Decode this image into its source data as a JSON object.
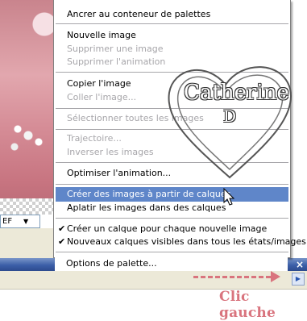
{
  "menu": {
    "items": [
      {
        "label": "Ancrer au conteneur de palettes",
        "enabled": true
      },
      {
        "label": "Nouvelle image",
        "enabled": true
      },
      {
        "label": "Supprimer une image",
        "enabled": false
      },
      {
        "label": "Supprimer l'animation",
        "enabled": false
      },
      {
        "label": "Copier l'image",
        "enabled": true
      },
      {
        "label": "Coller l'image...",
        "enabled": false
      },
      {
        "label": "Sélectionner toutes les images",
        "enabled": false
      },
      {
        "label": "Trajectoire...",
        "enabled": false
      },
      {
        "label": "Inverser les images",
        "enabled": false
      },
      {
        "label": "Optimiser l'animation...",
        "enabled": true
      },
      {
        "label": "Créer des images à partir de calques",
        "enabled": true,
        "selected": true
      },
      {
        "label": "Aplatir les images dans des calques",
        "enabled": true
      },
      {
        "label": "Créer un calque pour chaque nouvelle image",
        "enabled": true,
        "checked": true
      },
      {
        "label": "Nouveaux calques visibles dans tous les états/images",
        "enabled": true,
        "checked": true
      },
      {
        "label": "Options de palette...",
        "enabled": true
      }
    ]
  },
  "background": {
    "combo_value": "EF"
  },
  "panel": {
    "close_glyph": "×"
  },
  "annotation": {
    "label": "Clic gauche",
    "color": "#d9747e"
  },
  "watermark": {
    "name": "Catherine",
    "initial": "D"
  },
  "colors": {
    "menu_highlight": "#5f86c9",
    "disabled_text": "#a7a6aa",
    "title_bar": "#3c5fa8"
  }
}
